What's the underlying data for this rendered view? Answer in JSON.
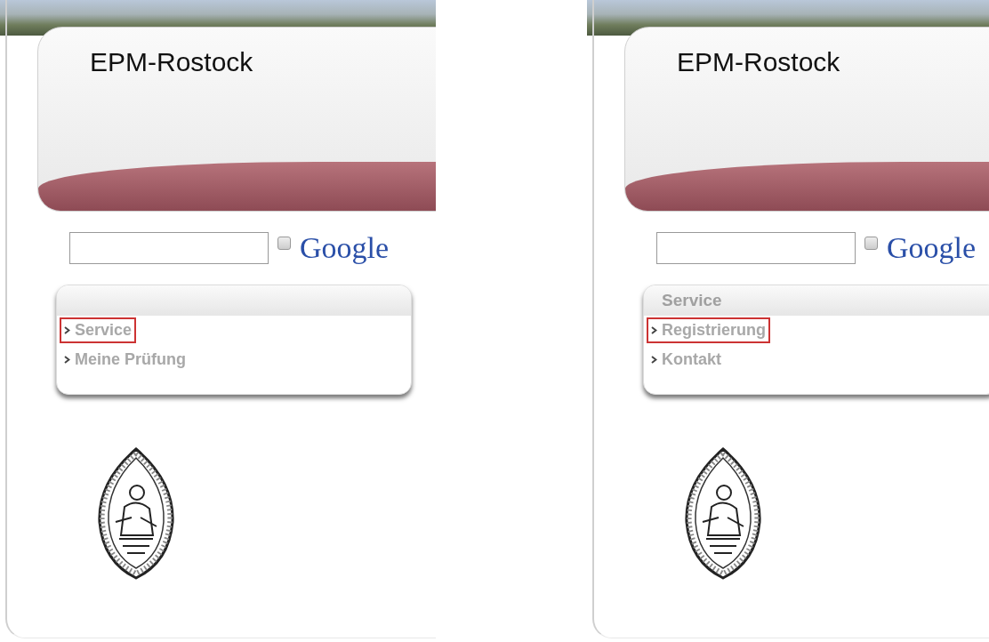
{
  "panels": [
    {
      "site_title": "EPM-Rostock",
      "search": {
        "checked": false,
        "engine": "Google"
      },
      "menu": {
        "items": [
          {
            "label": "Service",
            "selected": true
          },
          {
            "label": "Meine Prüfung",
            "selected": false
          }
        ]
      }
    },
    {
      "site_title": "EPM-Rostock",
      "search": {
        "checked": false,
        "engine": "Google"
      },
      "menu": {
        "heading": "Service",
        "items": [
          {
            "label": "Registrierung",
            "selected": true
          },
          {
            "label": "Kontakt",
            "selected": false
          }
        ]
      }
    }
  ]
}
